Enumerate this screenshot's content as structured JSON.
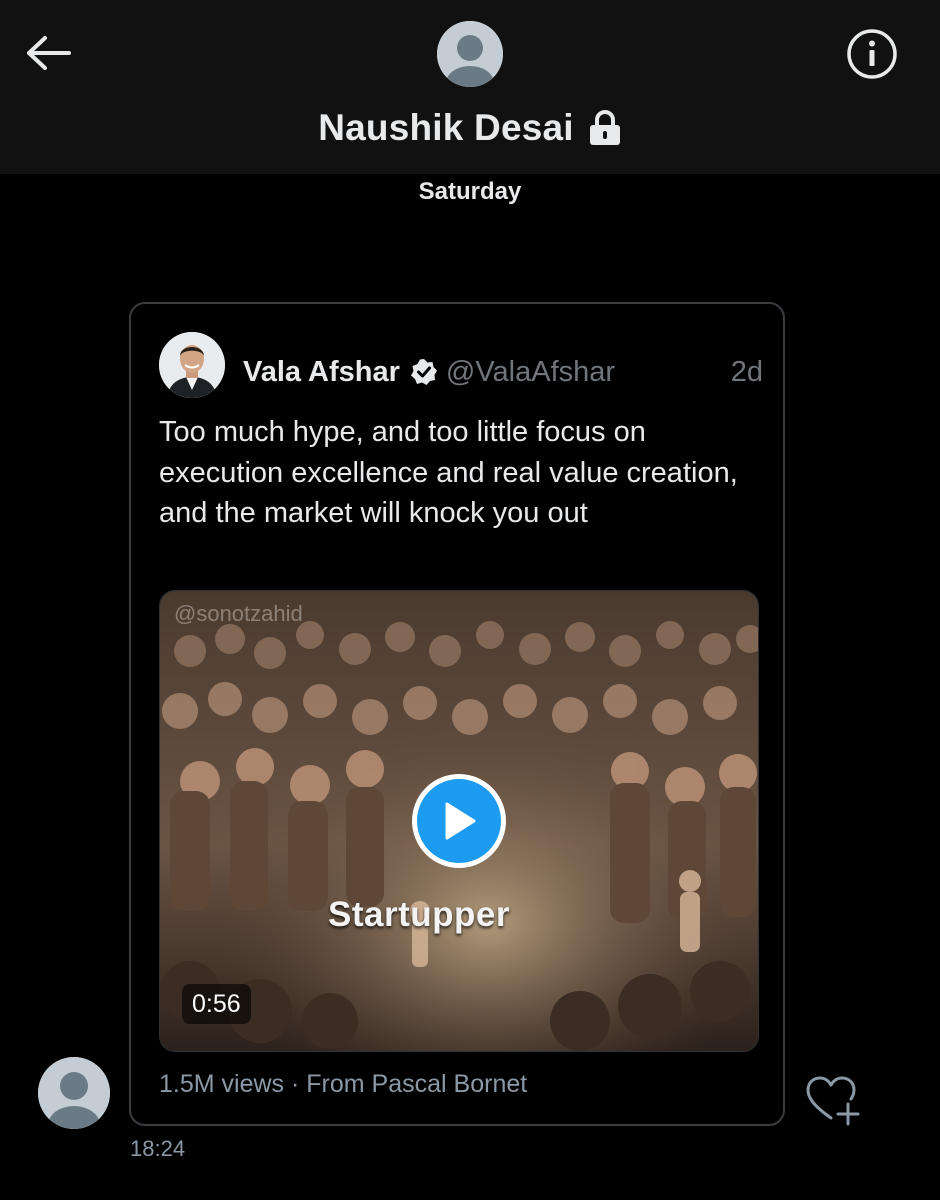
{
  "header": {
    "back_icon": "arrow-left-icon",
    "info_icon": "info-icon",
    "avatar_icon": "default-avatar-icon",
    "title": "Naushik Desai",
    "title_icon": "lock-icon"
  },
  "conversation": {
    "day_separator": "Saturday",
    "message": {
      "sender_avatar_icon": "default-avatar-icon",
      "timestamp": "18:24",
      "like_icon": "heart-plus-icon",
      "tweet": {
        "author_name": "Vala Afshar",
        "verified_icon": "verified-badge-icon",
        "handle": "@ValaAfshar",
        "time_ago": "2d",
        "text": "Too much hype, and too little focus on execution excellence and real value creation, and the market will knock you out",
        "video": {
          "watermark": "@sonotzahid",
          "caption": "Startupper",
          "duration": "0:56",
          "play_icon": "play-icon"
        },
        "views": "1.5M views",
        "separator": "·",
        "source": "From Pascal Bornet"
      }
    }
  },
  "colors": {
    "background": "#000000",
    "header_background": "#111111",
    "accent": "#1d9bf0",
    "secondary_text": "#71767b",
    "card_border": "#3a3d40"
  }
}
